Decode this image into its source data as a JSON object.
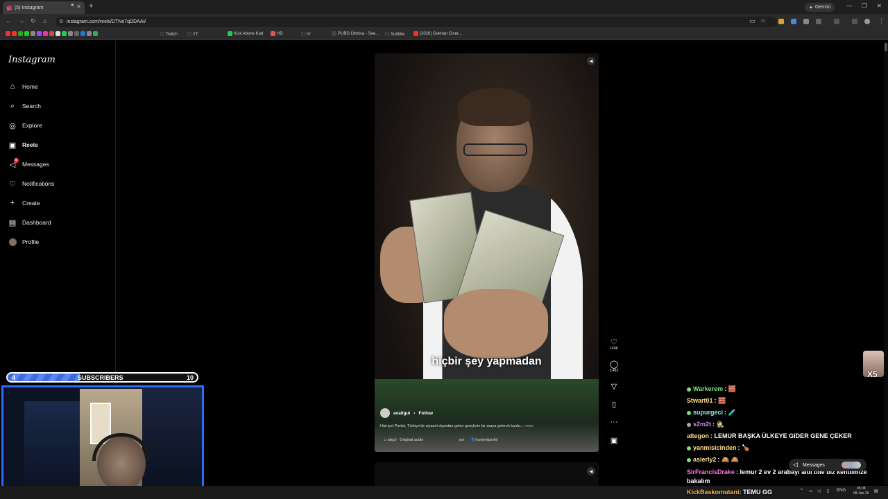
{
  "browser": {
    "tab_title": "(5) Instagram",
    "url": "instagram.com/reels/DTNo7qDDAAt/",
    "gemini_label": "Gemini",
    "bookmarks": [
      "Twitch",
      "YT",
      "Kick Abone Kod",
      "HD",
      "IV",
      "PUBG Ülmbra - See...",
      "Subtitle",
      "(2026) Gokhan Ciner..."
    ]
  },
  "instagram": {
    "logo": "Instagram",
    "nav": [
      {
        "label": "Home",
        "icon": "home-icon"
      },
      {
        "label": "Search",
        "icon": "search-icon"
      },
      {
        "label": "Explore",
        "icon": "compass-icon"
      },
      {
        "label": "Reels",
        "icon": "reels-icon"
      },
      {
        "label": "Messages",
        "icon": "messenger-icon"
      },
      {
        "label": "Notifications",
        "icon": "heart-icon"
      },
      {
        "label": "Create",
        "icon": "plus-icon"
      },
      {
        "label": "Dashboard",
        "icon": "dashboard-icon"
      },
      {
        "label": "Profile",
        "icon": "avatar-icon"
      }
    ],
    "messages_badge": "5"
  },
  "reel": {
    "subtitle": "hiçbir şey yapmadan",
    "username": "avaligul",
    "follow": "Follow",
    "caption": "Hürriyet Partisi, Türkiye'de siyaset dışından gelen gençlerin bir araya gelerek kurdu...",
    "more": "more",
    "audio": "aligul · Original audio",
    "tagged_a": "avi",
    "tagged_b": "hurriyetpartitr",
    "likes": "146K",
    "comments": "3,483"
  },
  "stream": {
    "sub_start": "4",
    "sub_label": "SUBSCRIBERS",
    "sub_goal": "10",
    "sub_progress": 0.38,
    "sticker_text": "X5",
    "chat": [
      {
        "user": "Warkerem",
        "color": "#7fe07f",
        "msg": "🧱"
      },
      {
        "user": "Stwart01",
        "color": "#ffe08a",
        "msg": "🧱"
      },
      {
        "user": "supurgeci",
        "color": "#8ef0e0",
        "msg": "🧪"
      },
      {
        "user": "s2m2t",
        "color": "#c98cf5",
        "msg": "🕵"
      },
      {
        "user": "altegon",
        "color": "#ffe08a",
        "msg": "LEMUR BAŞKA ÜLKEYE GIDER GENE ÇEKER"
      },
      {
        "user": "yanmisicinden",
        "color": "#ffe08a",
        "msg": "🍗"
      },
      {
        "user": "asierly2",
        "color": "#ffe08a",
        "msg": "🙈 🙈"
      },
      {
        "user": "SirFrancisDrake",
        "color": "#ff7be5",
        "msg": "lemur 2 ev 2 arabayı aldı bile biz kendimize bakalım"
      },
      {
        "user": "KickBaskomutani",
        "color": "#ffb347",
        "msg": "TEMU GG"
      }
    ],
    "messages_pill": "Messages"
  },
  "taskbar": {
    "lang": "ENG",
    "time": "05:08",
    "date": "08-Jan-26"
  }
}
